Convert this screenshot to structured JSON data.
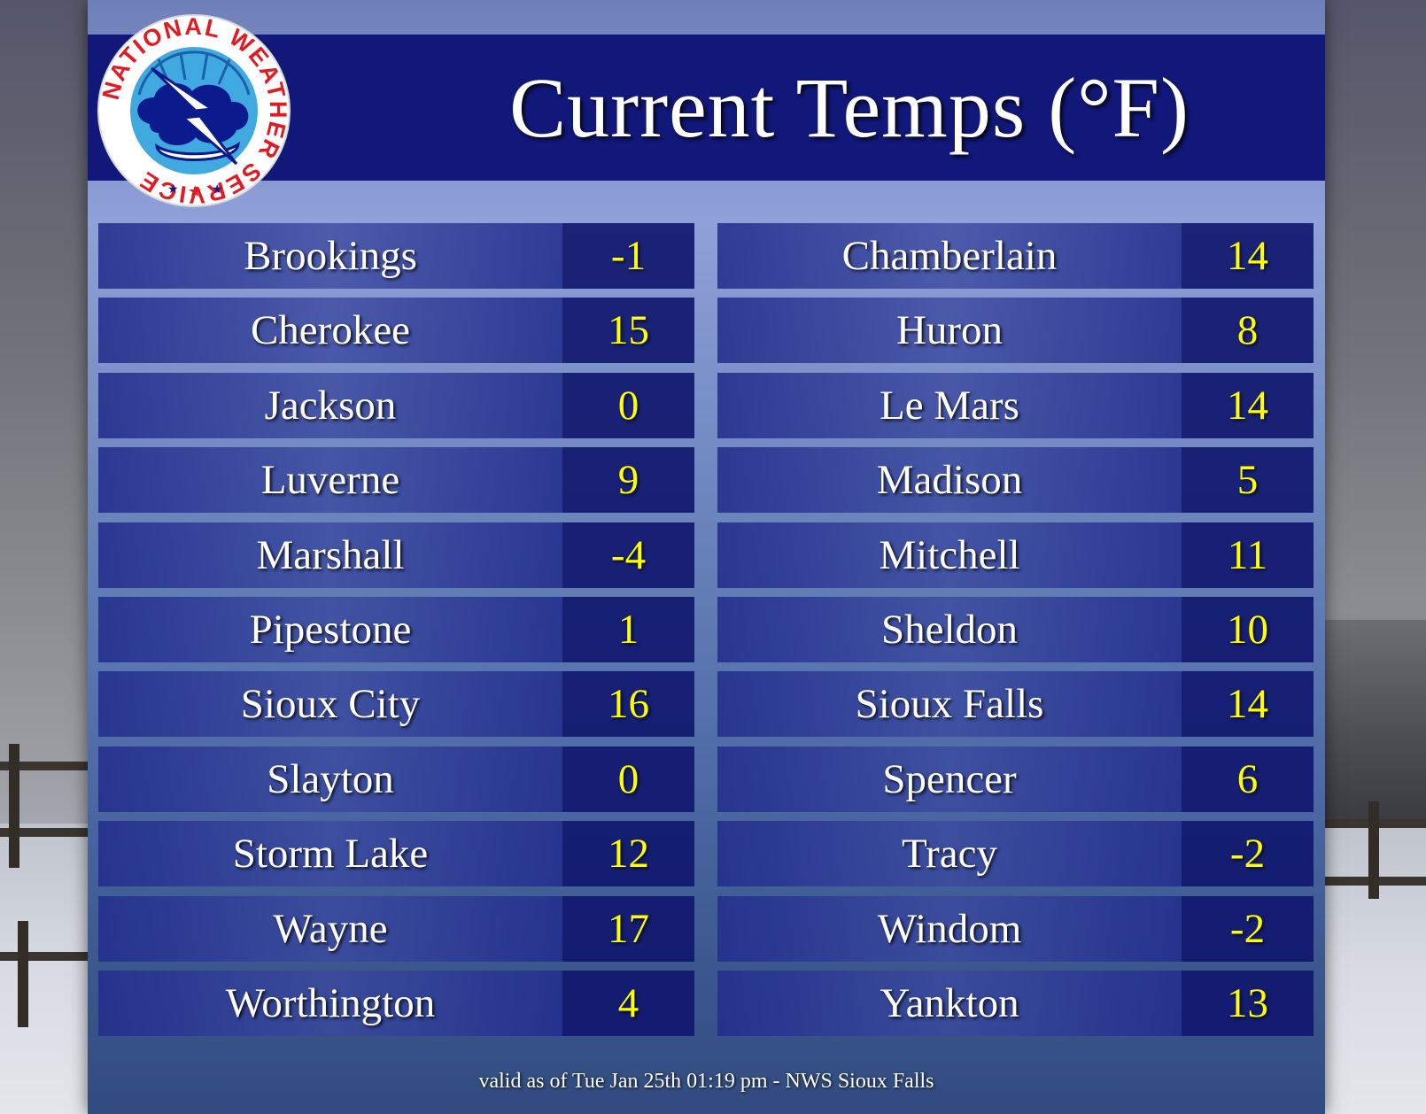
{
  "title": "Current Temps (°F)",
  "logo": {
    "text": "NATIONAL WEATHER SERVICE",
    "icon": "nws-logo-icon",
    "colors": {
      "ring_text": "#e01b23",
      "cloud": "#0b1a8c",
      "sky": "#3fa9e0",
      "bolt": "#ffffff"
    }
  },
  "colors": {
    "header_band": "#11187a",
    "city_cell": "#2e3a9a",
    "temp_cell": "#10186e",
    "temp_text": "#ffff00",
    "city_text": "#ffffff"
  },
  "left_column": [
    {
      "city": "Brookings",
      "temp": "-1"
    },
    {
      "city": "Cherokee",
      "temp": "15"
    },
    {
      "city": "Jackson",
      "temp": "0"
    },
    {
      "city": "Luverne",
      "temp": "9"
    },
    {
      "city": "Marshall",
      "temp": "-4"
    },
    {
      "city": "Pipestone",
      "temp": "1"
    },
    {
      "city": "Sioux City",
      "temp": "16"
    },
    {
      "city": "Slayton",
      "temp": "0"
    },
    {
      "city": "Storm Lake",
      "temp": "12"
    },
    {
      "city": "Wayne",
      "temp": "17"
    },
    {
      "city": "Worthington",
      "temp": "4"
    }
  ],
  "right_column": [
    {
      "city": "Chamberlain",
      "temp": "14"
    },
    {
      "city": "Huron",
      "temp": "8"
    },
    {
      "city": "Le Mars",
      "temp": "14"
    },
    {
      "city": "Madison",
      "temp": "5"
    },
    {
      "city": "Mitchell",
      "temp": "11"
    },
    {
      "city": "Sheldon",
      "temp": "10"
    },
    {
      "city": "Sioux Falls",
      "temp": "14"
    },
    {
      "city": "Spencer",
      "temp": "6"
    },
    {
      "city": "Tracy",
      "temp": "-2"
    },
    {
      "city": "Windom",
      "temp": "-2"
    },
    {
      "city": "Yankton",
      "temp": "13"
    }
  ],
  "footer": "valid as of Tue Jan 25th 01:19 pm - NWS Sioux Falls"
}
